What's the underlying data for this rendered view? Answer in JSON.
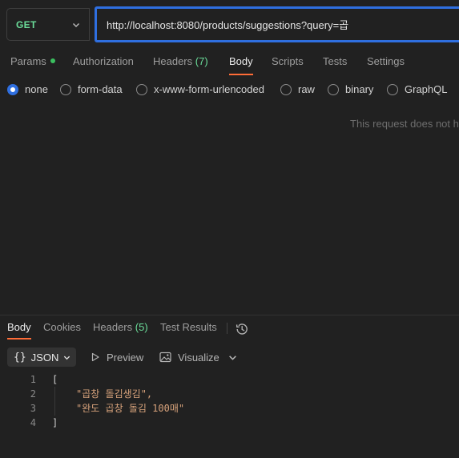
{
  "request": {
    "method": "GET",
    "url": "http://localhost:8080/products/suggestions?query=곱"
  },
  "request_tabs": [
    {
      "label": "Params",
      "indicator": "dot"
    },
    {
      "label": "Authorization"
    },
    {
      "label": "Headers",
      "count": "(7)"
    },
    {
      "label": "Body",
      "active": true
    },
    {
      "label": "Scripts"
    },
    {
      "label": "Tests"
    },
    {
      "label": "Settings"
    }
  ],
  "body_types": [
    {
      "label": "none",
      "selected": true
    },
    {
      "label": "form-data"
    },
    {
      "label": "x-www-form-urlencoded"
    },
    {
      "label": "raw"
    },
    {
      "label": "binary"
    },
    {
      "label": "GraphQL"
    }
  ],
  "empty_note": "This request does not ha",
  "response_tabs": [
    {
      "label": "Body",
      "active": true
    },
    {
      "label": "Cookies"
    },
    {
      "label": "Headers",
      "count": "(5)"
    },
    {
      "label": "Test Results"
    }
  ],
  "response_toolbar": {
    "format": "JSON",
    "preview": "Preview",
    "visualize": "Visualize"
  },
  "response_body": {
    "line_numbers": [
      "1",
      "2",
      "3",
      "4"
    ],
    "open": "[",
    "items": [
      "\"곱창 돌김생김\",",
      "\"완도 곱창 돌김 100매\""
    ],
    "close": "]"
  },
  "colors": {
    "accent_orange": "#ff6c37",
    "method_green": "#6bdd9a",
    "focus_blue": "#2f6fe0",
    "string": "#d7a27b"
  }
}
